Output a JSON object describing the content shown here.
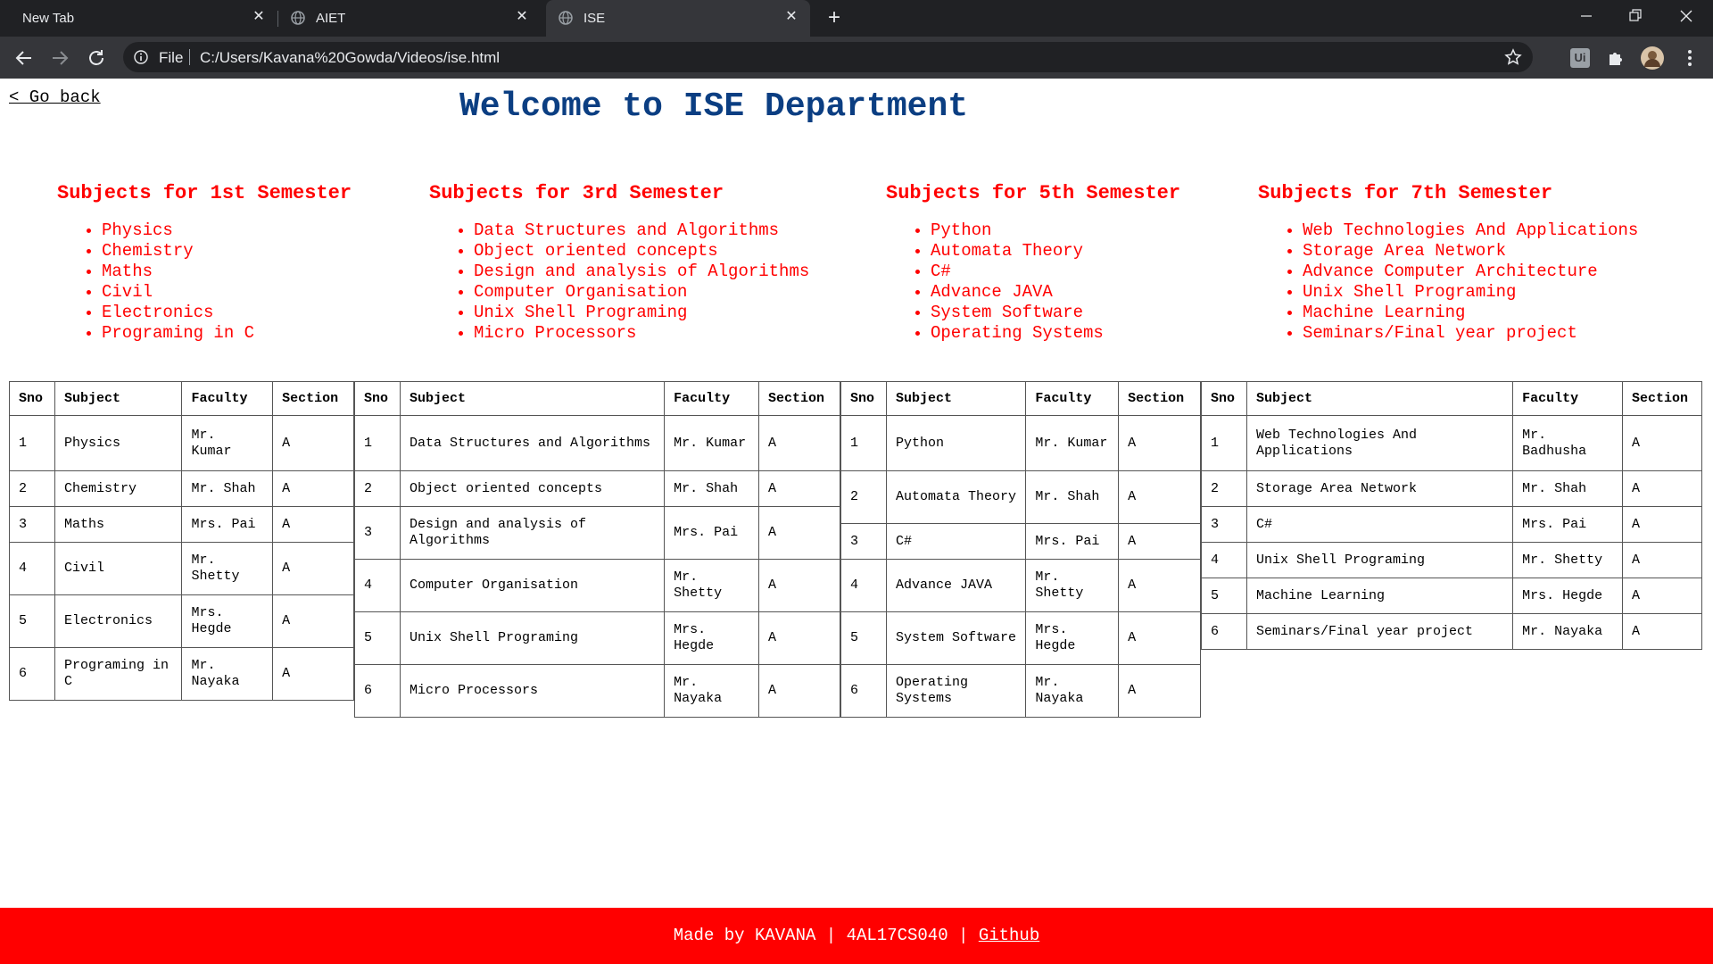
{
  "browser": {
    "tabs": [
      {
        "title": "New Tab"
      },
      {
        "title": "AIET"
      },
      {
        "title": "ISE"
      }
    ],
    "address": {
      "scheme_label": "File",
      "url": "C:/Users/Kavana%20Gowda/Videos/ise.html"
    },
    "extension_badge": "Ui"
  },
  "page": {
    "go_back": "< Go back",
    "title": "Welcome to ISE Department",
    "semesters": [
      {
        "heading": "Subjects for 1st Semester",
        "subjects": [
          "Physics",
          "Chemistry",
          "Maths",
          "Civil",
          "Electronics",
          "Programing in C"
        ]
      },
      {
        "heading": "Subjects for 3rd Semester",
        "subjects": [
          "Data Structures and Algorithms",
          "Object oriented concepts",
          "Design and analysis of Algorithms",
          "Computer Organisation",
          "Unix Shell Programing",
          "Micro Processors"
        ]
      },
      {
        "heading": "Subjects for 5th Semester",
        "subjects": [
          "Python",
          "Automata Theory",
          "C#",
          "Advance JAVA",
          "System Software",
          "Operating Systems"
        ]
      },
      {
        "heading": "Subjects for 7th Semester",
        "subjects": [
          "Web Technologies And Applications",
          "Storage Area Network",
          "Advance Computer Architecture",
          "Unix Shell Programing",
          "Machine Learning",
          "Seminars/Final year project"
        ]
      }
    ],
    "table_headers": {
      "sno": "Sno",
      "subject": "Subject",
      "faculty": "Faculty",
      "section": "Section"
    },
    "tables": [
      {
        "rows": [
          {
            "sno": "1",
            "subject": "Physics",
            "faculty": "Mr. Kumar",
            "section": "A"
          },
          {
            "sno": "2",
            "subject": "Chemistry",
            "faculty": "Mr. Shah",
            "section": "A"
          },
          {
            "sno": "3",
            "subject": "Maths",
            "faculty": "Mrs. Pai",
            "section": "A"
          },
          {
            "sno": "4",
            "subject": "Civil",
            "faculty": "Mr. Shetty",
            "section": "A"
          },
          {
            "sno": "5",
            "subject": "Electronics",
            "faculty": "Mrs. Hegde",
            "section": "A"
          },
          {
            "sno": "6",
            "subject": "Programing in C",
            "faculty": "Mr. Nayaka",
            "section": "A"
          }
        ]
      },
      {
        "rows": [
          {
            "sno": "1",
            "subject": "Data Structures and Algorithms",
            "faculty": "Mr. Kumar",
            "section": "A"
          },
          {
            "sno": "2",
            "subject": "Object oriented concepts",
            "faculty": "Mr. Shah",
            "section": "A"
          },
          {
            "sno": "3",
            "subject": "Design and analysis of Algorithms",
            "faculty": "Mrs. Pai",
            "section": "A"
          },
          {
            "sno": "4",
            "subject": "Computer Organisation",
            "faculty": "Mr. Shetty",
            "section": "A"
          },
          {
            "sno": "5",
            "subject": "Unix Shell Programing",
            "faculty": "Mrs. Hegde",
            "section": "A"
          },
          {
            "sno": "6",
            "subject": "Micro Processors",
            "faculty": "Mr. Nayaka",
            "section": "A"
          }
        ]
      },
      {
        "rows": [
          {
            "sno": "1",
            "subject": "Python",
            "faculty": "Mr. Kumar",
            "section": "A"
          },
          {
            "sno": "2",
            "subject": "Automata Theory",
            "faculty": "Mr. Shah",
            "section": "A"
          },
          {
            "sno": "3",
            "subject": "C#",
            "faculty": "Mrs. Pai",
            "section": "A"
          },
          {
            "sno": "4",
            "subject": "Advance JAVA",
            "faculty": "Mr. Shetty",
            "section": "A"
          },
          {
            "sno": "5",
            "subject": "System Software",
            "faculty": "Mrs. Hegde",
            "section": "A"
          },
          {
            "sno": "6",
            "subject": "Operating Systems",
            "faculty": "Mr. Nayaka",
            "section": "A"
          }
        ]
      },
      {
        "rows": [
          {
            "sno": "1",
            "subject": "Web Technologies And Applications",
            "faculty": "Mr. Badhusha",
            "section": "A"
          },
          {
            "sno": "2",
            "subject": "Storage Area Network",
            "faculty": "Mr. Shah",
            "section": "A"
          },
          {
            "sno": "3",
            "subject": "C#",
            "faculty": "Mrs. Pai",
            "section": "A"
          },
          {
            "sno": "4",
            "subject": "Unix Shell Programing",
            "faculty": "Mr. Shetty",
            "section": "A"
          },
          {
            "sno": "5",
            "subject": "Machine Learning",
            "faculty": "Mrs. Hegde",
            "section": "A"
          },
          {
            "sno": "6",
            "subject": "Seminars/Final year project",
            "faculty": "Mr. Nayaka",
            "section": "A"
          }
        ]
      }
    ],
    "footer": {
      "made_by": "Made by KAVANA | 4AL17CS040 | ",
      "github": "Github"
    }
  },
  "colors": {
    "title": "#0b3e82",
    "subjects": "#ff0000",
    "footer": "#ff0000"
  }
}
